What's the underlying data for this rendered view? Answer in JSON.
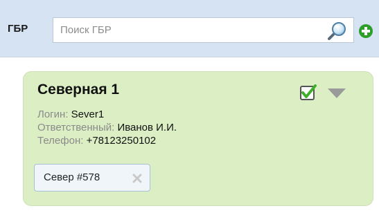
{
  "header": {
    "title": "ГБР",
    "search": {
      "placeholder": "Поиск ГБР",
      "value": ""
    },
    "search_icon": "search-icon",
    "add_icon": "add-icon"
  },
  "card": {
    "title": "Северная 1",
    "login": {
      "label": "Логин:",
      "value": "Sever1"
    },
    "responsible": {
      "label": "Ответственный:",
      "value": "Иванов И.И."
    },
    "phone": {
      "label": "Телефон:",
      "value": "+78123250102"
    },
    "checked": true,
    "tag": {
      "label": "Север #578"
    }
  },
  "colors": {
    "header_bg": "#d5e3f2",
    "card_bg": "#dcefc4",
    "add_green": "#2e9e2a",
    "check_green": "#3fae2a",
    "caret_gray": "#9a9a9a"
  }
}
